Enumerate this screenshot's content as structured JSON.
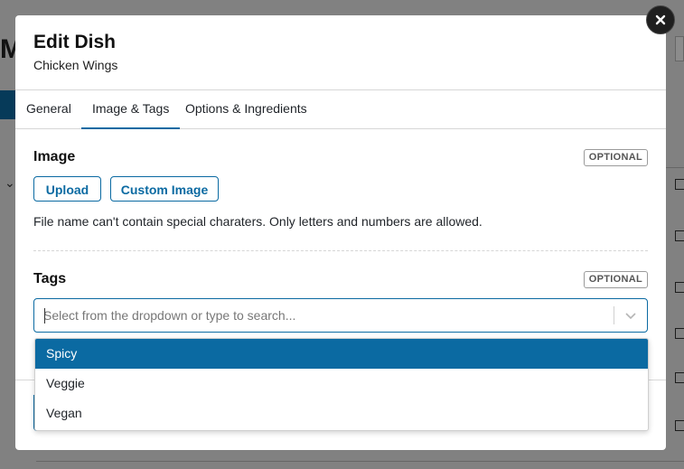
{
  "background": {
    "title_fragment": "M"
  },
  "modal": {
    "title": "Edit Dish",
    "subtitle": "Chicken Wings",
    "close_icon": "close-icon"
  },
  "tabs": [
    {
      "label": "General",
      "active": false
    },
    {
      "label": "Image & Tags",
      "active": true
    },
    {
      "label": "Options & Ingredients",
      "active": false
    }
  ],
  "image_section": {
    "label": "Image",
    "badge": "OPTIONAL",
    "upload_label": "Upload",
    "custom_image_label": "Custom Image",
    "helper_text": "File name can't contain special charaters. Only letters and numbers are allowed."
  },
  "tags_section": {
    "label": "Tags",
    "badge": "OPTIONAL",
    "select": {
      "placeholder": "Select from the dropdown or type to search...",
      "value": ""
    },
    "options": [
      {
        "label": "Spicy",
        "highlighted": true
      },
      {
        "label": "Veggie",
        "highlighted": false
      },
      {
        "label": "Vegan",
        "highlighted": false
      }
    ]
  },
  "colors": {
    "accent": "#0b6aa2",
    "overlay": "#6f6f6f",
    "close_button": "#1f1f1f"
  }
}
